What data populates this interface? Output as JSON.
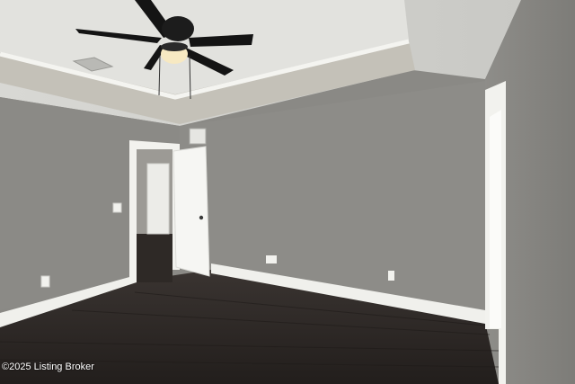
{
  "photo": {
    "subject": "empty-bedroom-interior",
    "watermark": "©2025 Listing Broker",
    "colors": {
      "wall": "#8c8b87",
      "ceiling": "#dcdcd8",
      "floor": "#2a2624",
      "trim": "#f2f2ef"
    }
  }
}
